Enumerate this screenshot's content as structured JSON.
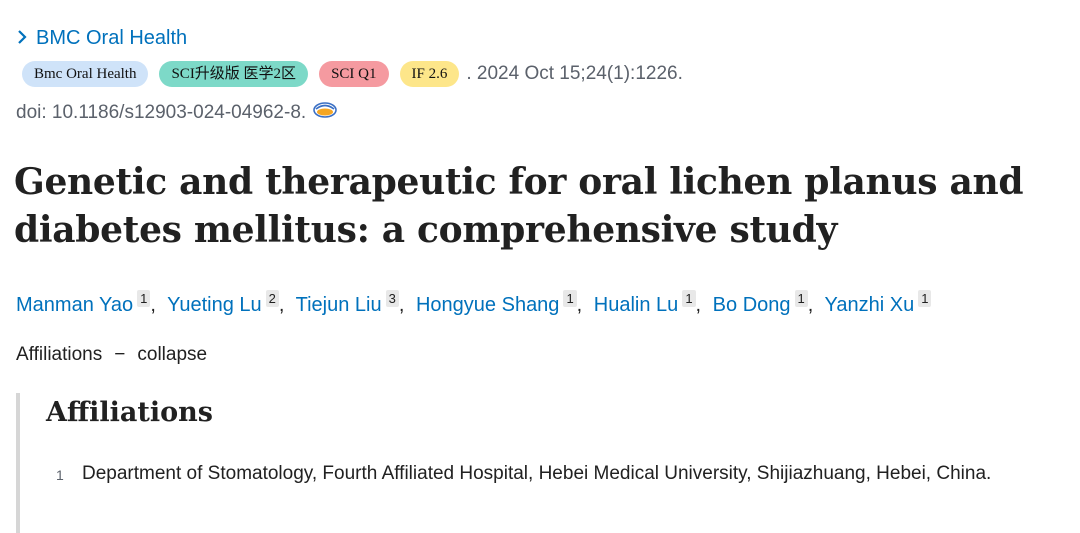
{
  "journal": {
    "link_label": "BMC Oral Health",
    "chevron_glyph": "›"
  },
  "badges": [
    {
      "label": "Bmc Oral Health",
      "color": "#cfe3f9"
    },
    {
      "label": "SCI升级版 医学2区",
      "color": "#7dd9c8"
    },
    {
      "label": "SCI Q1",
      "color": "#f59aa0"
    },
    {
      "label": "IF 2.6",
      "color": "#fde68a"
    }
  ],
  "citation": ". 2024 Oct 15;24(1):1226.",
  "doi": "doi: 10.1186/s12903-024-04962-8.",
  "doi_icon": "reading-glasses-icon",
  "title": "Genetic and therapeutic for oral lichen planus and diabetes mellitus: a comprehensive study",
  "authors": [
    {
      "name": "Manman Yao",
      "aff": "1"
    },
    {
      "name": "Yueting Lu",
      "aff": "2"
    },
    {
      "name": "Tiejun Liu",
      "aff": "3"
    },
    {
      "name": "Hongyue Shang",
      "aff": "1"
    },
    {
      "name": "Hualin Lu",
      "aff": "1"
    },
    {
      "name": "Bo Dong",
      "aff": "1"
    },
    {
      "name": "Yanzhi Xu",
      "aff": "1"
    }
  ],
  "affiliations_toggle": {
    "label": "Affiliations",
    "dash": "−",
    "action": "collapse"
  },
  "affiliations": {
    "heading": "Affiliations",
    "items": [
      {
        "num": "1",
        "text": "Department of Stomatology, Fourth Affiliated Hospital, Hebei Medical University, Shijiazhuang, Hebei, China."
      }
    ]
  },
  "colors": {
    "link": "#0071bc",
    "text": "#212121",
    "muted": "#5b616b"
  }
}
